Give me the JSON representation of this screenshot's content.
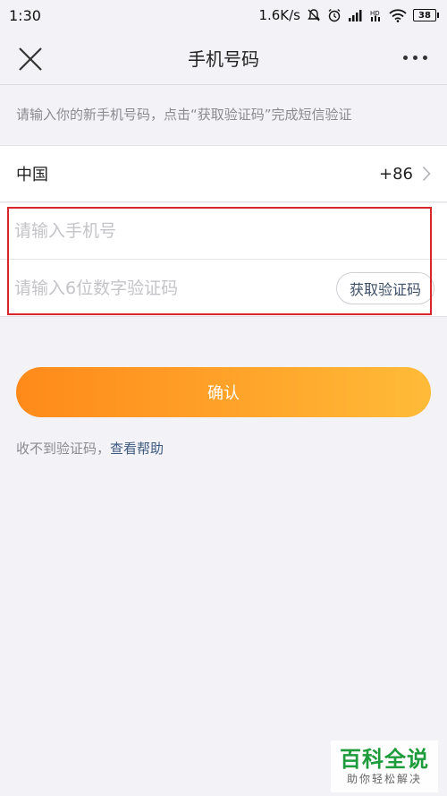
{
  "status_bar": {
    "time": "1:30",
    "network_speed": "1.6K/s",
    "icons": [
      "mute-icon",
      "alarm-icon",
      "signal-icon",
      "hd-icon",
      "wifi-icon"
    ],
    "battery": "38"
  },
  "header": {
    "title": "手机号码",
    "close_icon": "close-icon",
    "more_icon": "more-icon"
  },
  "hint": "请输入你的新手机号码，点击“获取验证码”完成短信验证",
  "country": {
    "name": "中国",
    "code": "+86"
  },
  "form": {
    "phone_placeholder": "请输入手机号",
    "phone_value": "",
    "code_placeholder": "请输入6位数字验证码",
    "code_value": "",
    "get_code_label": "获取验证码"
  },
  "confirm_label": "确认",
  "help": {
    "text": "收不到验证码，",
    "link": "查看帮助"
  },
  "watermark": {
    "main": "百科全说",
    "sub": "助你轻松解决"
  },
  "colors": {
    "accent_start": "#ff8a1a",
    "accent_end": "#ffbb38",
    "highlight": "#d8262d",
    "link": "#3d5a80"
  }
}
